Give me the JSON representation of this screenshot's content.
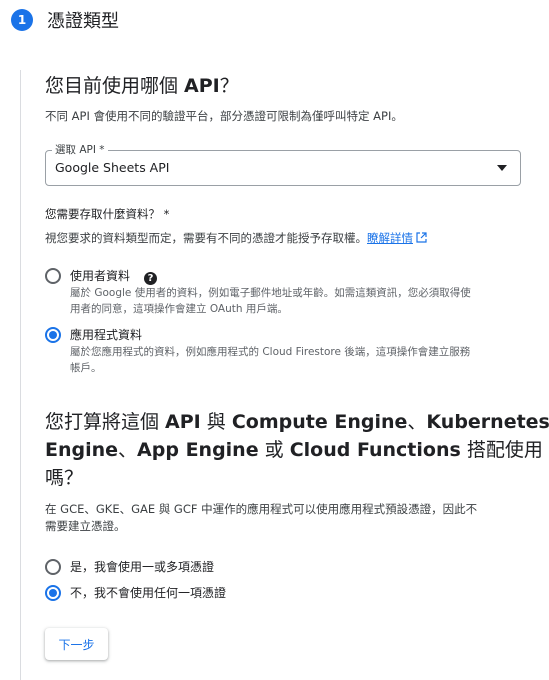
{
  "step": {
    "number": "1",
    "title": "憑證類型"
  },
  "api_section": {
    "heading_pre": "您目前使用哪個 ",
    "heading_bold": "API",
    "heading_post": "？",
    "description": "不同 API 會使用不同的驗證平台，部分憑證可限制為僅呼叫特定 API。",
    "select": {
      "label": "選取 API *",
      "value": "Google Sheets API"
    }
  },
  "data_section": {
    "question": "您需要存取什麼資料？ *",
    "description": "視您要求的資料類型而定，需要有不同的憑證才能授予存取權。",
    "learn_more": "瞭解詳情",
    "options": [
      {
        "label": "使用者資料",
        "sub1": "屬於 Google 使用者的資料，例如電子郵件地址或年齡。如需這類資訊，您必須取得使",
        "sub2": "用者的同意，這項操作會建立 OAuth 用戶端。",
        "checked": false
      },
      {
        "label": "應用程式資料",
        "sub1": "屬於您應用程式的資料，例如應用程式的 Cloud Firestore 後端，這項操作會建立服務",
        "sub2": "帳戶。",
        "checked": true
      }
    ]
  },
  "compute_section": {
    "heading_line1_pre": "您打算將這個 ",
    "heading_line1_b1": "API",
    "heading_line1_mid": " 與 ",
    "heading_line1_b2": "Compute Engine",
    "heading_line1_sep": "、",
    "heading_line1_b3": "Kubernetes",
    "heading_line2_b1": "Engine",
    "heading_line2_sep1": "、",
    "heading_line2_b2": "App Engine",
    "heading_line2_or": " 或 ",
    "heading_line2_b3": "Cloud Functions",
    "heading_line2_post": " 搭配使用",
    "heading_line3": "嗎？",
    "description_line1": "在 GCE、GKE、GAE 與 GCF 中運作的應用程式可以使用應用程式預設憑證，因此不",
    "description_line2": "需要建立憑證。",
    "options": [
      {
        "label": "是，我會使用一或多項憑證",
        "checked": false
      },
      {
        "label": "不，我不會使用任何一項憑證",
        "checked": true
      }
    ]
  },
  "next_button": "下一步",
  "colors": {
    "accent": "#1a73e8",
    "text": "#202124",
    "secondary": "#5f6368",
    "rail": "#dadce0"
  },
  "icons": {
    "help": "help-circle-icon",
    "external": "open-in-new-icon",
    "dropdown": "dropdown-arrow-icon"
  }
}
